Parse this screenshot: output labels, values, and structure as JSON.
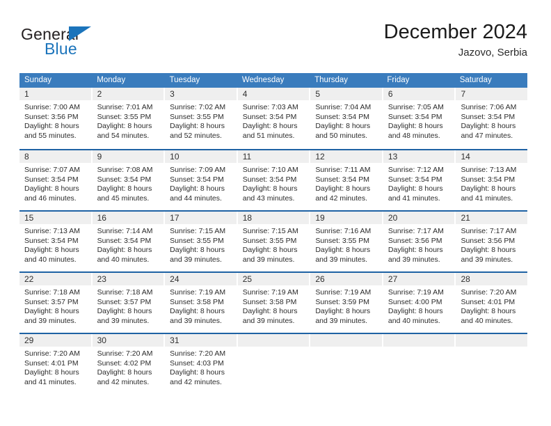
{
  "brand": {
    "word_one": "General",
    "word_two": "Blue",
    "logo_icon": "triangle-flag-icon"
  },
  "header": {
    "title": "December 2024",
    "location": "Jazovo, Serbia"
  },
  "calendar": {
    "weekday_labels": [
      "Sunday",
      "Monday",
      "Tuesday",
      "Wednesday",
      "Thursday",
      "Friday",
      "Saturday"
    ],
    "accent_color": "#3a7cbd",
    "rule_color": "#1e62a4",
    "daynum_bg": "#efefef",
    "weeks": [
      [
        {
          "day": "1",
          "sunrise": "Sunrise: 7:00 AM",
          "sunset": "Sunset: 3:56 PM",
          "daylight_line1": "Daylight: 8 hours",
          "daylight_line2": "and 55 minutes."
        },
        {
          "day": "2",
          "sunrise": "Sunrise: 7:01 AM",
          "sunset": "Sunset: 3:55 PM",
          "daylight_line1": "Daylight: 8 hours",
          "daylight_line2": "and 54 minutes."
        },
        {
          "day": "3",
          "sunrise": "Sunrise: 7:02 AM",
          "sunset": "Sunset: 3:55 PM",
          "daylight_line1": "Daylight: 8 hours",
          "daylight_line2": "and 52 minutes."
        },
        {
          "day": "4",
          "sunrise": "Sunrise: 7:03 AM",
          "sunset": "Sunset: 3:54 PM",
          "daylight_line1": "Daylight: 8 hours",
          "daylight_line2": "and 51 minutes."
        },
        {
          "day": "5",
          "sunrise": "Sunrise: 7:04 AM",
          "sunset": "Sunset: 3:54 PM",
          "daylight_line1": "Daylight: 8 hours",
          "daylight_line2": "and 50 minutes."
        },
        {
          "day": "6",
          "sunrise": "Sunrise: 7:05 AM",
          "sunset": "Sunset: 3:54 PM",
          "daylight_line1": "Daylight: 8 hours",
          "daylight_line2": "and 48 minutes."
        },
        {
          "day": "7",
          "sunrise": "Sunrise: 7:06 AM",
          "sunset": "Sunset: 3:54 PM",
          "daylight_line1": "Daylight: 8 hours",
          "daylight_line2": "and 47 minutes."
        }
      ],
      [
        {
          "day": "8",
          "sunrise": "Sunrise: 7:07 AM",
          "sunset": "Sunset: 3:54 PM",
          "daylight_line1": "Daylight: 8 hours",
          "daylight_line2": "and 46 minutes."
        },
        {
          "day": "9",
          "sunrise": "Sunrise: 7:08 AM",
          "sunset": "Sunset: 3:54 PM",
          "daylight_line1": "Daylight: 8 hours",
          "daylight_line2": "and 45 minutes."
        },
        {
          "day": "10",
          "sunrise": "Sunrise: 7:09 AM",
          "sunset": "Sunset: 3:54 PM",
          "daylight_line1": "Daylight: 8 hours",
          "daylight_line2": "and 44 minutes."
        },
        {
          "day": "11",
          "sunrise": "Sunrise: 7:10 AM",
          "sunset": "Sunset: 3:54 PM",
          "daylight_line1": "Daylight: 8 hours",
          "daylight_line2": "and 43 minutes."
        },
        {
          "day": "12",
          "sunrise": "Sunrise: 7:11 AM",
          "sunset": "Sunset: 3:54 PM",
          "daylight_line1": "Daylight: 8 hours",
          "daylight_line2": "and 42 minutes."
        },
        {
          "day": "13",
          "sunrise": "Sunrise: 7:12 AM",
          "sunset": "Sunset: 3:54 PM",
          "daylight_line1": "Daylight: 8 hours",
          "daylight_line2": "and 41 minutes."
        },
        {
          "day": "14",
          "sunrise": "Sunrise: 7:13 AM",
          "sunset": "Sunset: 3:54 PM",
          "daylight_line1": "Daylight: 8 hours",
          "daylight_line2": "and 41 minutes."
        }
      ],
      [
        {
          "day": "15",
          "sunrise": "Sunrise: 7:13 AM",
          "sunset": "Sunset: 3:54 PM",
          "daylight_line1": "Daylight: 8 hours",
          "daylight_line2": "and 40 minutes."
        },
        {
          "day": "16",
          "sunrise": "Sunrise: 7:14 AM",
          "sunset": "Sunset: 3:54 PM",
          "daylight_line1": "Daylight: 8 hours",
          "daylight_line2": "and 40 minutes."
        },
        {
          "day": "17",
          "sunrise": "Sunrise: 7:15 AM",
          "sunset": "Sunset: 3:55 PM",
          "daylight_line1": "Daylight: 8 hours",
          "daylight_line2": "and 39 minutes."
        },
        {
          "day": "18",
          "sunrise": "Sunrise: 7:15 AM",
          "sunset": "Sunset: 3:55 PM",
          "daylight_line1": "Daylight: 8 hours",
          "daylight_line2": "and 39 minutes."
        },
        {
          "day": "19",
          "sunrise": "Sunrise: 7:16 AM",
          "sunset": "Sunset: 3:55 PM",
          "daylight_line1": "Daylight: 8 hours",
          "daylight_line2": "and 39 minutes."
        },
        {
          "day": "20",
          "sunrise": "Sunrise: 7:17 AM",
          "sunset": "Sunset: 3:56 PM",
          "daylight_line1": "Daylight: 8 hours",
          "daylight_line2": "and 39 minutes."
        },
        {
          "day": "21",
          "sunrise": "Sunrise: 7:17 AM",
          "sunset": "Sunset: 3:56 PM",
          "daylight_line1": "Daylight: 8 hours",
          "daylight_line2": "and 39 minutes."
        }
      ],
      [
        {
          "day": "22",
          "sunrise": "Sunrise: 7:18 AM",
          "sunset": "Sunset: 3:57 PM",
          "daylight_line1": "Daylight: 8 hours",
          "daylight_line2": "and 39 minutes."
        },
        {
          "day": "23",
          "sunrise": "Sunrise: 7:18 AM",
          "sunset": "Sunset: 3:57 PM",
          "daylight_line1": "Daylight: 8 hours",
          "daylight_line2": "and 39 minutes."
        },
        {
          "day": "24",
          "sunrise": "Sunrise: 7:19 AM",
          "sunset": "Sunset: 3:58 PM",
          "daylight_line1": "Daylight: 8 hours",
          "daylight_line2": "and 39 minutes."
        },
        {
          "day": "25",
          "sunrise": "Sunrise: 7:19 AM",
          "sunset": "Sunset: 3:58 PM",
          "daylight_line1": "Daylight: 8 hours",
          "daylight_line2": "and 39 minutes."
        },
        {
          "day": "26",
          "sunrise": "Sunrise: 7:19 AM",
          "sunset": "Sunset: 3:59 PM",
          "daylight_line1": "Daylight: 8 hours",
          "daylight_line2": "and 39 minutes."
        },
        {
          "day": "27",
          "sunrise": "Sunrise: 7:19 AM",
          "sunset": "Sunset: 4:00 PM",
          "daylight_line1": "Daylight: 8 hours",
          "daylight_line2": "and 40 minutes."
        },
        {
          "day": "28",
          "sunrise": "Sunrise: 7:20 AM",
          "sunset": "Sunset: 4:01 PM",
          "daylight_line1": "Daylight: 8 hours",
          "daylight_line2": "and 40 minutes."
        }
      ],
      [
        {
          "day": "29",
          "sunrise": "Sunrise: 7:20 AM",
          "sunset": "Sunset: 4:01 PM",
          "daylight_line1": "Daylight: 8 hours",
          "daylight_line2": "and 41 minutes."
        },
        {
          "day": "30",
          "sunrise": "Sunrise: 7:20 AM",
          "sunset": "Sunset: 4:02 PM",
          "daylight_line1": "Daylight: 8 hours",
          "daylight_line2": "and 42 minutes."
        },
        {
          "day": "31",
          "sunrise": "Sunrise: 7:20 AM",
          "sunset": "Sunset: 4:03 PM",
          "daylight_line1": "Daylight: 8 hours",
          "daylight_line2": "and 42 minutes."
        },
        {
          "day": "",
          "sunrise": "",
          "sunset": "",
          "daylight_line1": "",
          "daylight_line2": ""
        },
        {
          "day": "",
          "sunrise": "",
          "sunset": "",
          "daylight_line1": "",
          "daylight_line2": ""
        },
        {
          "day": "",
          "sunrise": "",
          "sunset": "",
          "daylight_line1": "",
          "daylight_line2": ""
        },
        {
          "day": "",
          "sunrise": "",
          "sunset": "",
          "daylight_line1": "",
          "daylight_line2": ""
        }
      ]
    ]
  }
}
